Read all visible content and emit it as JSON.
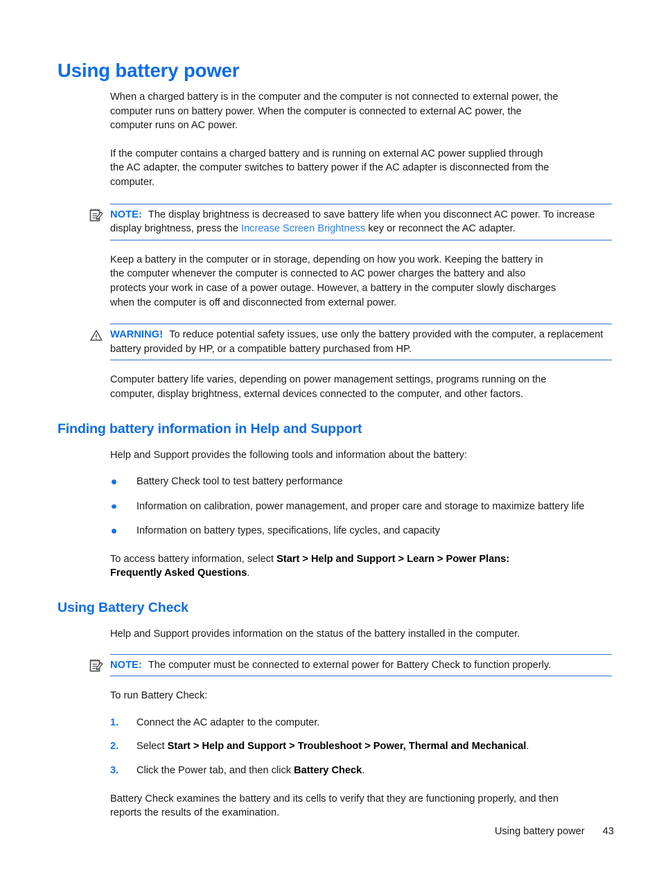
{
  "page": {
    "title": "Using battery power",
    "footer_text": "Using battery power",
    "footer_page_number": "43"
  },
  "colors": {
    "heading_blue": "#0d6ce8",
    "link_blue": "#2e7ff0",
    "bullet_blue": "#1a73e8",
    "rule_blue": "#2f6fd0",
    "body_text": "#1a1a1a"
  },
  "intro": {
    "paragraph_1": "When a charged battery is in the computer and the computer is not connected to external power, the computer runs on battery power. When the computer is connected to external AC power, the computer runs on AC power.",
    "paragraph_2": "If the computer contains a charged battery and is running on external AC power supplied through the AC adapter, the computer switches to battery power if the AC adapter is disconnected from the computer."
  },
  "note_1": {
    "icon": "note-pencil-icon",
    "label": "NOTE:",
    "text_before_link": "The display brightness is decreased to save battery life when you disconnect AC power. To increase display brightness, press the ",
    "link_text": "Increase Screen Brightness",
    "text_after_link": " key or reconnect the AC adapter."
  },
  "body": {
    "paragraph_3": "Keep a battery in the computer or in storage, depending on how you work. Keeping the battery in the computer whenever the computer is connected to AC power charges the battery and also protects your work in case of a power outage. However, a battery in the computer slowly discharges when the computer is off and disconnected from external power.",
    "paragraph_4": "Computer battery life varies, depending on power management settings, programs running on the computer, display brightness, external devices connected to the computer, and other factors."
  },
  "warning": {
    "icon": "warning-triangle-icon",
    "label": "WARNING!",
    "text": "To reduce potential safety issues, use only the battery provided with the computer, a replacement battery provided by HP, or a compatible battery purchased from HP."
  },
  "section_finding": {
    "heading": "Finding battery information in Help and Support",
    "intro": "Help and Support provides the following tools and information about the battery:",
    "bullets": [
      "Battery Check tool to test battery performance",
      "Information on calibration, power management, and proper care and storage to maximize battery life",
      "Information on battery types, specifications, life cycles, and capacity"
    ],
    "access_prefix": "To access battery information, select ",
    "access_bold": "Start > Help and Support > Learn > Power Plans: Frequently Asked Questions",
    "access_suffix": "."
  },
  "section_battery_check": {
    "heading": "Using Battery Check",
    "intro": "Help and Support provides information on the status of the battery installed in the computer.",
    "note": {
      "icon": "note-pencil-icon",
      "label": "NOTE:",
      "text": "The computer must be connected to external power for Battery Check to function properly."
    },
    "run_label": "To run Battery Check:",
    "steps": [
      {
        "number": "1.",
        "prefix": "Connect the AC adapter to the computer.",
        "bold": "",
        "suffix": ""
      },
      {
        "number": "2.",
        "prefix": "Select ",
        "bold": "Start > Help and Support > Troubleshoot > Power, Thermal and Mechanical",
        "suffix": "."
      },
      {
        "number": "3.",
        "prefix": "Click the Power tab, and then click ",
        "bold": "Battery Check",
        "suffix": "."
      }
    ],
    "closing": "Battery Check examines the battery and its cells to verify that they are functioning properly, and then reports the results of the examination."
  }
}
